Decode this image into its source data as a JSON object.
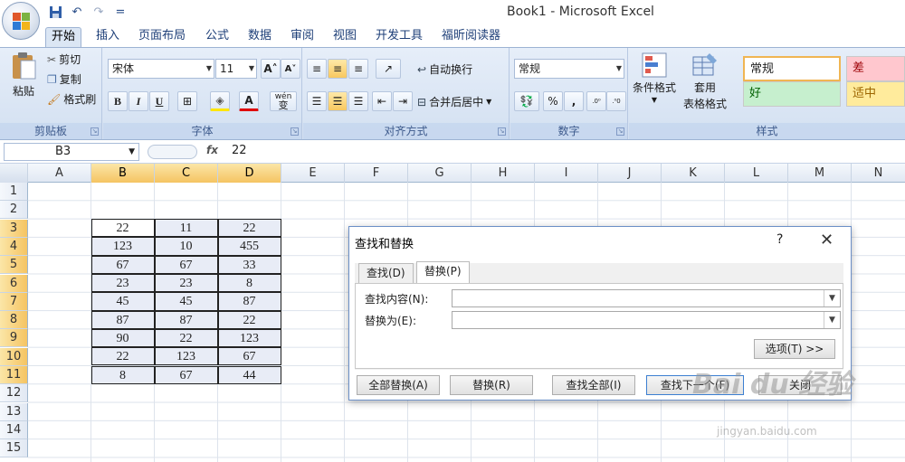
{
  "app": {
    "title": "Book1 - Microsoft Excel"
  },
  "qat": {
    "save": "save-icon",
    "undo": "undo-icon",
    "redo": "redo-icon",
    "customize": "="
  },
  "tabs": [
    "开始",
    "插入",
    "页面布局",
    "公式",
    "数据",
    "审阅",
    "视图",
    "开发工具",
    "福昕阅读器"
  ],
  "ribbon": {
    "clipboard": {
      "label": "剪贴板",
      "paste": "粘贴",
      "cut": "剪切",
      "copy": "复制",
      "format_painter": "格式刷"
    },
    "font": {
      "label": "字体",
      "font_name": "宋体",
      "font_size": "11",
      "bold": "B",
      "italic": "I",
      "underline": "U",
      "grow": "A",
      "shrink": "A",
      "font_color": "A",
      "wen": "wén",
      "wen2": "变"
    },
    "alignment": {
      "label": "对齐方式",
      "wrap": "自动换行",
      "merge": "合并后居中"
    },
    "number": {
      "label": "数字",
      "format": "常规",
      "percent": "%",
      "comma": ",",
      "inc": ".0→.00",
      "dec": ".00→.0"
    },
    "styles": {
      "label": "样式",
      "cond_format": "条件格式",
      "table_format_1": "套用",
      "table_format_2": "表格格式",
      "normal": "常规",
      "bad": "差",
      "good": "好",
      "neutral": "适中"
    }
  },
  "formula_bar": {
    "name_box": "B3",
    "fx": "fx",
    "value": "22"
  },
  "columns": [
    "A",
    "B",
    "C",
    "D",
    "E",
    "F",
    "G",
    "H",
    "I",
    "J",
    "K",
    "L",
    "M",
    "N"
  ],
  "rows": [
    "1",
    "2",
    "3",
    "4",
    "5",
    "6",
    "7",
    "8",
    "9",
    "10",
    "11",
    "12",
    "13",
    "14",
    "15"
  ],
  "table": [
    [
      "22",
      "11",
      "22"
    ],
    [
      "123",
      "10",
      "455"
    ],
    [
      "67",
      "67",
      "33"
    ],
    [
      "23",
      "23",
      "8"
    ],
    [
      "45",
      "45",
      "87"
    ],
    [
      "87",
      "87",
      "22"
    ],
    [
      "90",
      "22",
      "123"
    ],
    [
      "22",
      "123",
      "67"
    ],
    [
      "8",
      "67",
      "44"
    ]
  ],
  "dialog": {
    "title": "查找和替换",
    "help": "?",
    "close": "✕",
    "tab_find": "查找(D)",
    "tab_replace": "替换(P)",
    "find_label": "查找内容(N):",
    "replace_label": "替换为(E):",
    "find_value": "",
    "replace_value": "",
    "options": "选项(T) >>",
    "replace_all": "全部替换(A)",
    "replace": "替换(R)",
    "find_all": "查找全部(I)",
    "find_next": "查找下一个(F)",
    "close_btn": "关闭"
  },
  "watermark": {
    "main": "Bai du 经验",
    "url": "jingyan.baidu.com"
  }
}
